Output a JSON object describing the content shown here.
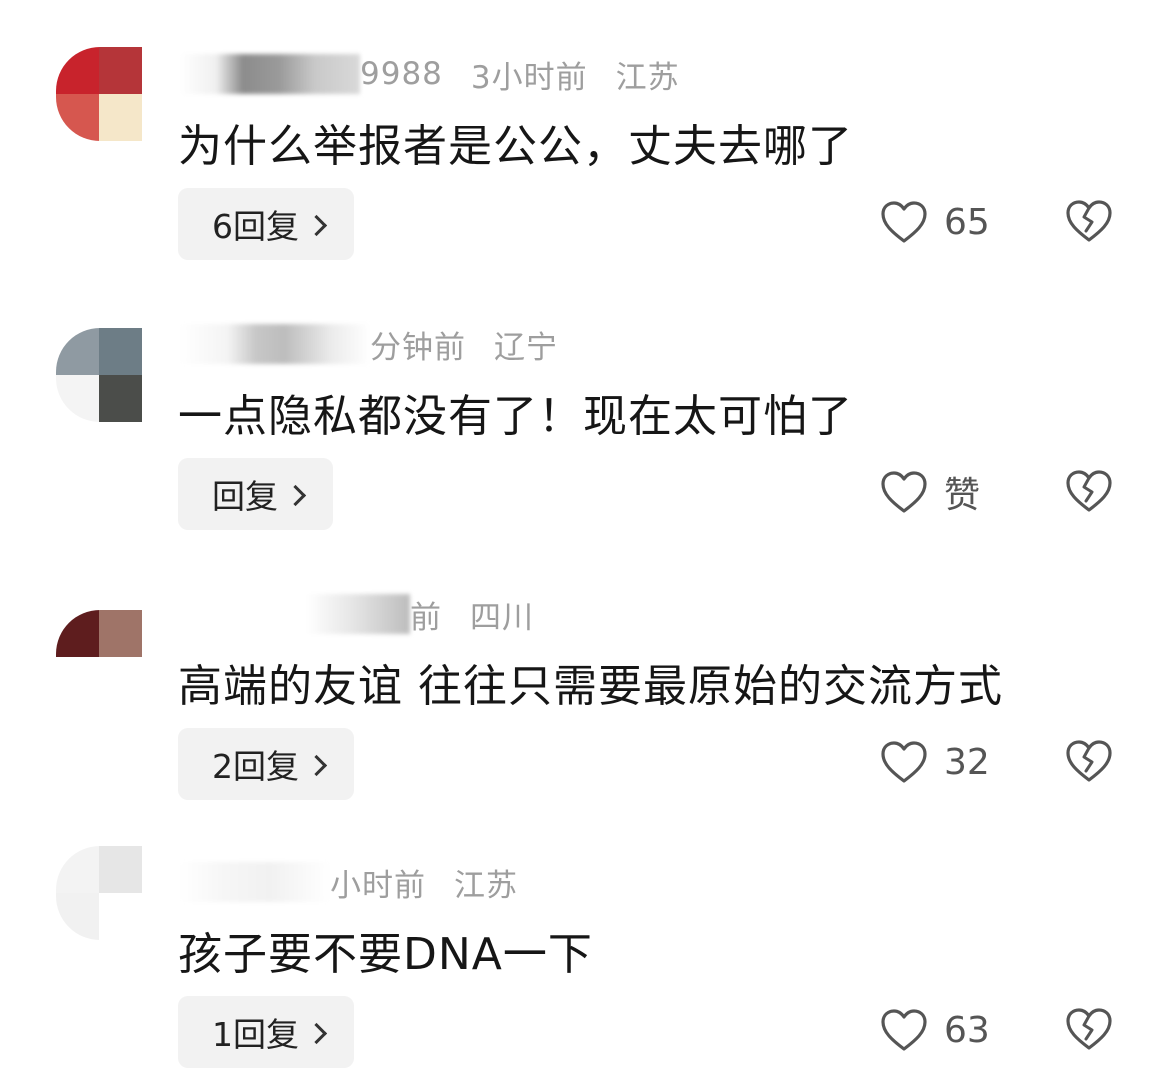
{
  "comments": [
    {
      "name_tail": "9988",
      "time": "3小时前",
      "location": "江苏",
      "text": "为什么举报者是公公，丈夫去哪了",
      "reply_label": "6回复",
      "likes": "65",
      "avatar_colors": [
        "#c8232c",
        "#b53539",
        "#d6574f",
        "#f5e7c9"
      ]
    },
    {
      "name_tail": "",
      "time": "分钟前",
      "location": "辽宁",
      "text": "一点隐私都没有了！现在太可怕了",
      "reply_label": "回复",
      "likes": "赞",
      "avatar_colors": [
        "#8f9aa2",
        "#6d7d86",
        "#f4f4f4",
        "#4b4d4a"
      ]
    },
    {
      "name_tail": "",
      "time": "前",
      "location": "四川",
      "text": "高端的友谊 往往只需要最原始的交流方式",
      "reply_label": "2回复",
      "likes": "32",
      "avatar_colors": [
        "#5e1d1e",
        "#9f7468",
        "#ffffff",
        "#ffffff"
      ]
    },
    {
      "name_tail": "",
      "time": "小时前",
      "location": "江苏",
      "text": "孩子要不要DNA一下",
      "reply_label": "1回复",
      "likes": "63",
      "avatar_colors": [
        "#f3f3f3",
        "#e6e6e6",
        "#f1f1f1",
        "#ffffff"
      ]
    }
  ],
  "icons": {
    "like": "heart-outline-icon",
    "dislike": "broken-heart-icon",
    "reply_arrow": "chevron-right-icon"
  }
}
